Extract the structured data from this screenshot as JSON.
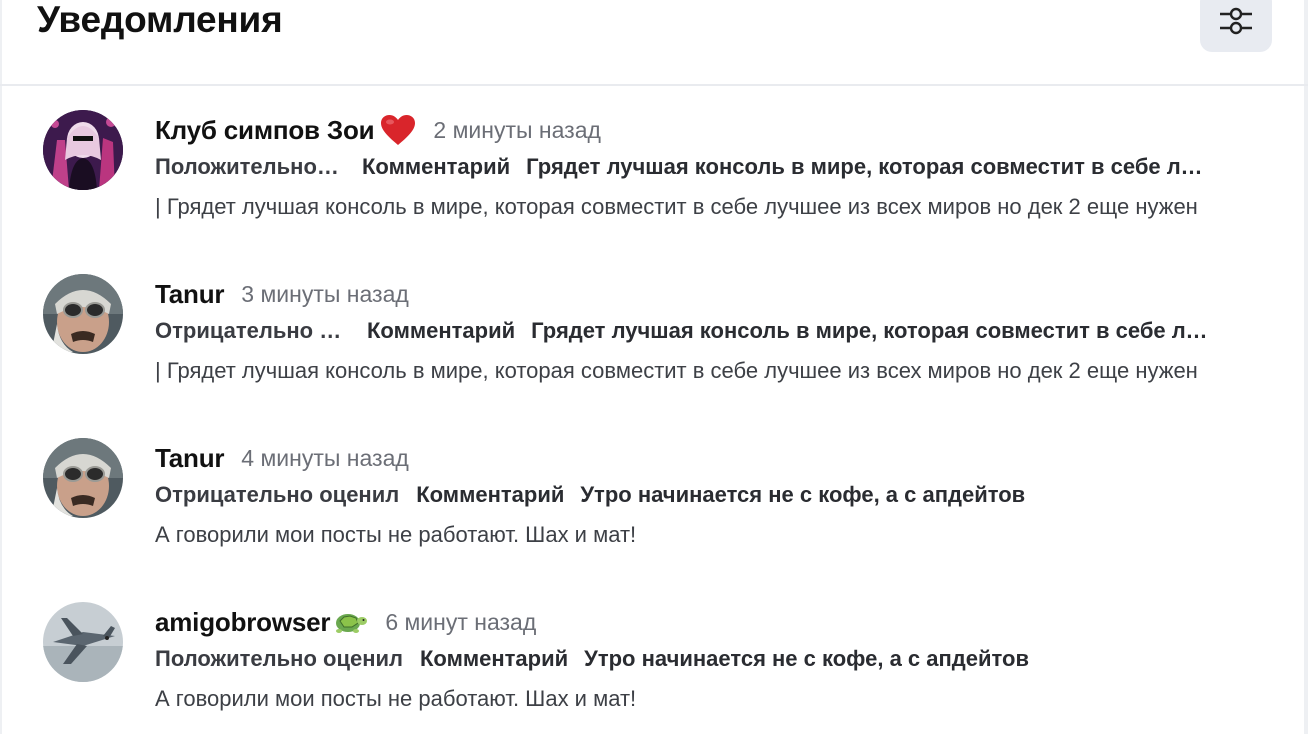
{
  "header": {
    "title": "Уведомления",
    "filter_icon": "sliders-icon"
  },
  "notifications": [
    {
      "author": "Клуб симпов Зои",
      "author_badge": "heart-emoji",
      "time": "2 минуты назад",
      "action": "Положительно оценил",
      "type": "Комментарий",
      "post": "Грядет лучшая консоль в мире, которая совместит в себе лучшее из всех миров",
      "text": "| Грядет лучшая консоль в мире, которая совместит в себе лучшее из всех миров но дек 2 еще нужен"
    },
    {
      "author": "Tanur",
      "time": "3 минуты назад",
      "action": "Отрицательно оценил",
      "type": "Комментарий",
      "post": "Грядет лучшая консоль в мире, которая совместит в себе лучшее из всех миров",
      "text": "| Грядет лучшая консоль в мире, которая совместит в себе лучшее из всех миров но дек 2 еще нужен"
    },
    {
      "author": "Tanur",
      "time": "4 минуты назад",
      "action": "Отрицательно оценил",
      "type": "Комментарий",
      "post": "Утро начинается не с кофе, а с апдейтов",
      "text": "А говорили мои посты не работают. Шах и мат!"
    },
    {
      "author": "amigobrowser",
      "author_badge": "turtle-emoji",
      "time": "6 минут назад",
      "action": "Положительно оценил",
      "type": "Комментарий",
      "post": "Утро начинается не с кофе, а с апдейтов",
      "text": "А говорили мои посты не работают. Шах и мат!"
    }
  ],
  "colors": {
    "accent_bg": "#e8ebf1",
    "muted_text": "#6b6e76",
    "heart": "#d9252b"
  }
}
